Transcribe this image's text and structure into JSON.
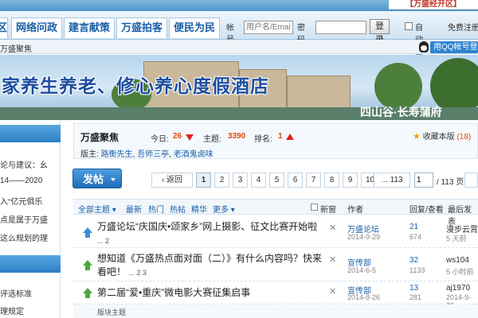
{
  "top_banner": {
    "right_text": "【万盛经开区】"
  },
  "nav": {
    "tabs": [
      "区",
      "网络问政",
      "建言献策",
      "万盛拍客",
      "便民为民"
    ],
    "login": {
      "account_label": "帐号",
      "account_placeholder": "用户名/Email",
      "password_label": "密码",
      "login_button": "登录",
      "auto_login": "自动登陆",
      "free_register": "免费注册",
      "qq_login": "用QQ帐号登录"
    }
  },
  "breadcrumb": "万盛聚焦",
  "banner": {
    "title": "家养生养老、修心养心度假酒店",
    "subtitle": "四山谷·长寿蒲府"
  },
  "sidebar": {
    "items": [
      "论与建议：幺",
      "14——2020",
      "入“亿元俱乐",
      "点是属于万盛",
      "这么规划的理",
      "评选标准",
      "理规定"
    ]
  },
  "forum": {
    "name": "万盛聚焦",
    "today_label": "今日:",
    "today_count": "26",
    "topics_label": "主题:",
    "topics_count": "3390",
    "rank_label": "排名:",
    "rank_value": "1",
    "moderators_label": "版主:",
    "moderators": [
      "路衡先生",
      "吾师三亭",
      "老酒鬼卤味"
    ],
    "favorite_label": "收藏本版",
    "favorite_count": "(18)"
  },
  "toolbar": {
    "post_button": "发帖",
    "prev": "返回",
    "pages": [
      "1",
      "2",
      "3",
      "4",
      "5",
      "6",
      "7",
      "8",
      "9",
      "10",
      "... 113"
    ],
    "current_page": "1",
    "page_total": "/ 113 页"
  },
  "table_header": {
    "filters": [
      "全部主题",
      "最新",
      "热门",
      "热帖",
      "精华",
      "更多"
    ],
    "new_window": "新窗",
    "author": "作者",
    "reply_view": "回复/查看",
    "last_post": "最后发表"
  },
  "threads": [
    {
      "title": "万盛论坛“庆国庆•颂家乡”网上摄影、征文比赛开始啦",
      "pages": "... 2",
      "author": "万盛论坛",
      "date": "2014-9-29",
      "replies": "21",
      "views": "674",
      "last_user": "漫步云霄",
      "last_time": "5 天前",
      "icon_color": "#3a8ed8"
    },
    {
      "title": "想知道《万盛热点面对面（二）》有什么内容吗？快来看吧！",
      "pages": "... 2 3",
      "author": "宣传部",
      "date": "2014-6-5",
      "replies": "32",
      "views": "1133",
      "last_user": "ws104",
      "last_time": "5 小时前",
      "icon_color": "#4caa3c"
    },
    {
      "title": "第二届“爱•重庆”微电影大赛征集启事",
      "pages": "",
      "author": "宣传部",
      "date": "2014-8-26",
      "replies": "13",
      "views": "281",
      "last_user": "aj1970",
      "last_time": "2014-9-26",
      "icon_color": "#4caa3c"
    }
  ],
  "pinned_label": "版块主题"
}
